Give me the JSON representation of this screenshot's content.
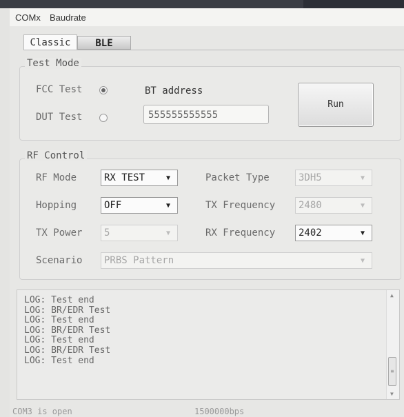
{
  "menu": {
    "items": [
      "COMx",
      "Baudrate"
    ]
  },
  "tabs": {
    "classic": "Classic",
    "ble": "BLE"
  },
  "test_mode": {
    "legend": "Test Mode",
    "fcc_label": "FCC Test",
    "fcc_selected": true,
    "dut_label": "DUT Test",
    "dut_selected": false,
    "bt_address_label": "BT address",
    "bt_address_value": "555555555555",
    "run_label": "Run"
  },
  "rf_control": {
    "legend": "RF Control",
    "rf_mode_label": "RF Mode",
    "rf_mode_value": "RX TEST",
    "hopping_label": "Hopping",
    "hopping_value": "OFF",
    "tx_power_label": "TX Power",
    "tx_power_value": "5",
    "scenario_label": "Scenario",
    "scenario_value": "PRBS Pattern",
    "packet_type_label": "Packet Type",
    "packet_type_value": "3DH5",
    "tx_frequency_label": "TX Frequency",
    "tx_frequency_value": "2480",
    "rx_frequency_label": "RX Frequency",
    "rx_frequency_value": "2402"
  },
  "log": {
    "lines": [
      "LOG: Test end",
      "LOG: BR/EDR Test",
      "LOG: Test end",
      "LOG: BR/EDR Test",
      "LOG: Test end",
      "LOG: BR/EDR Test",
      "LOG: Test end"
    ]
  },
  "status": {
    "port": "COM3 is open",
    "baud": "1500000bps"
  },
  "icons": {
    "dropdown": "chevron-down-icon",
    "scroll_up": "scroll-up-icon",
    "scroll_down": "scroll-down-icon",
    "scroll_thumb": "scroll-thumb-grip-icon"
  }
}
